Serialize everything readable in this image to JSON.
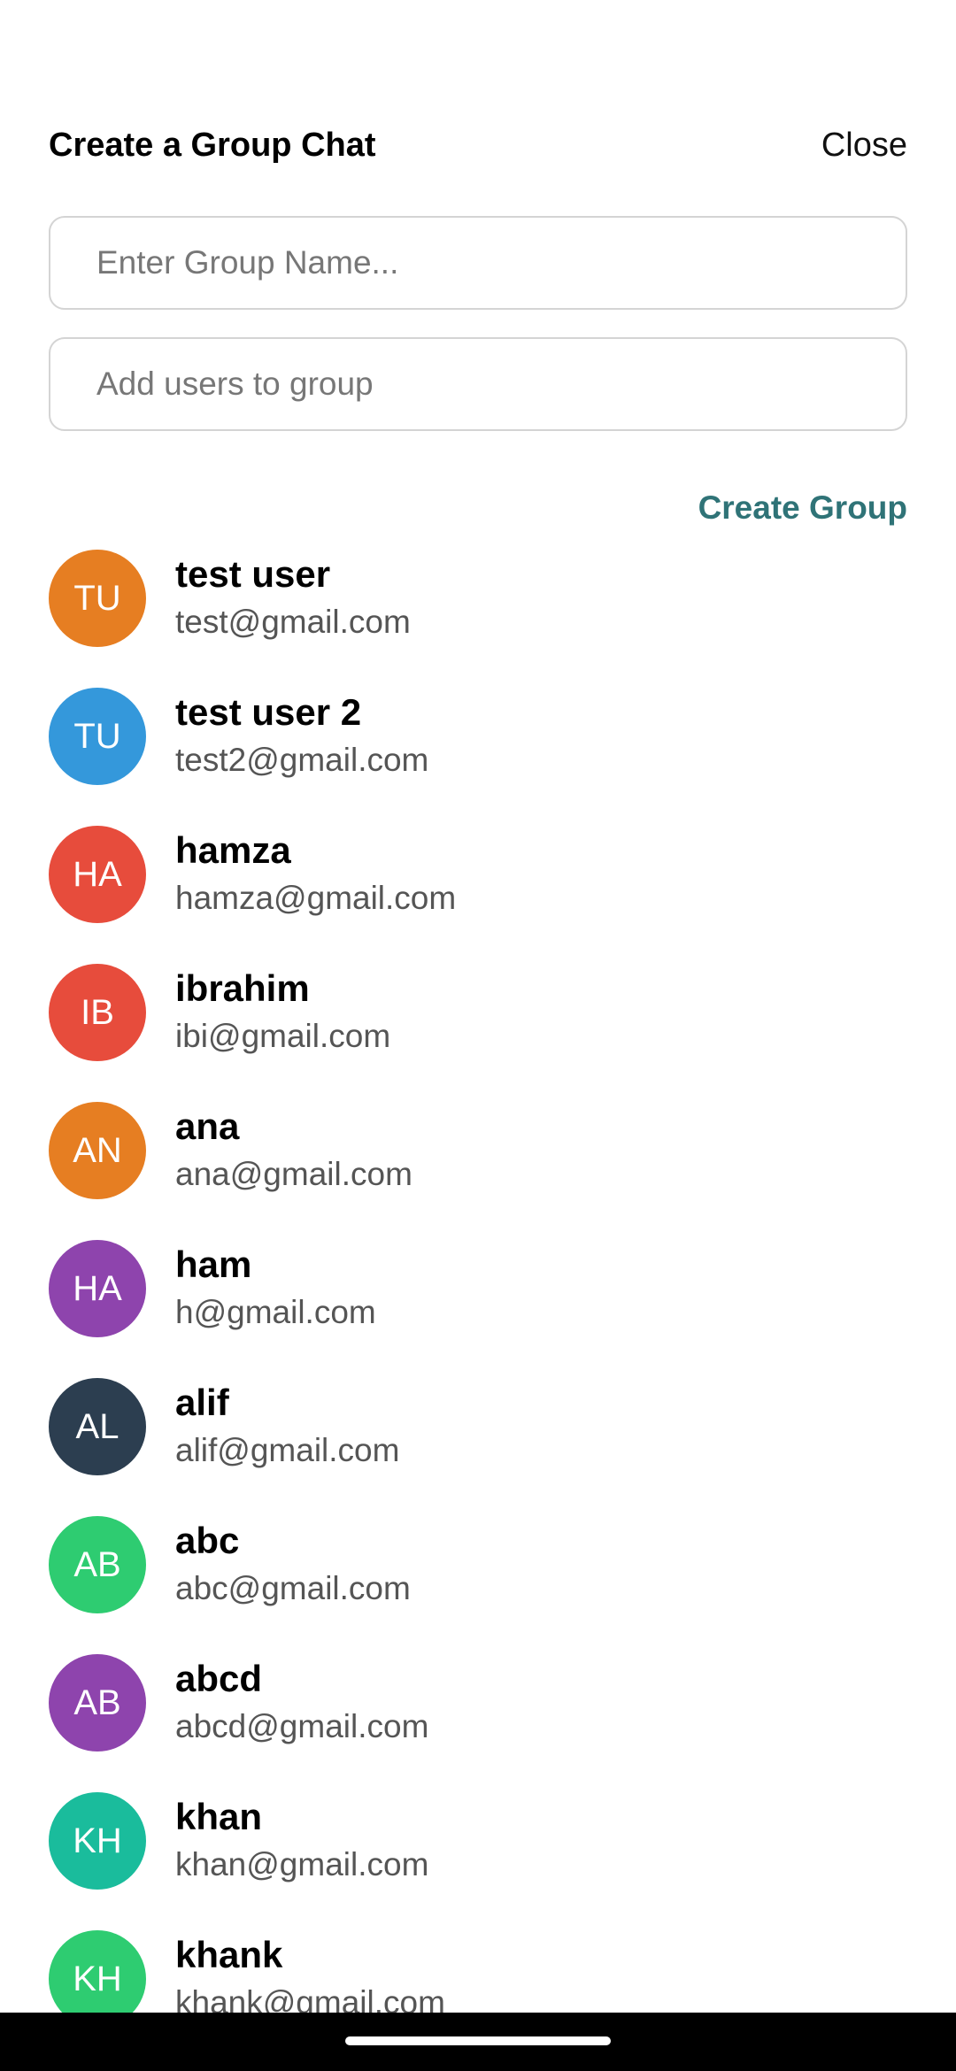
{
  "header": {
    "title": "Create a Group Chat",
    "close_label": "Close"
  },
  "form": {
    "group_name_placeholder": "Enter Group Name...",
    "group_name_value": "",
    "add_users_placeholder": "Add users to group",
    "add_users_value": "",
    "create_label": "Create Group"
  },
  "users": [
    {
      "initials": "TU",
      "name": "test user",
      "email": "test@gmail.com",
      "color": "#e67e22"
    },
    {
      "initials": "TU",
      "name": "test user 2",
      "email": "test2@gmail.com",
      "color": "#3498db"
    },
    {
      "initials": "HA",
      "name": "hamza",
      "email": "hamza@gmail.com",
      "color": "#e74c3c"
    },
    {
      "initials": "IB",
      "name": "ibrahim",
      "email": "ibi@gmail.com",
      "color": "#e74c3c"
    },
    {
      "initials": "AN",
      "name": "ana",
      "email": "ana@gmail.com",
      "color": "#e67e22"
    },
    {
      "initials": "HA",
      "name": "ham",
      "email": "h@gmail.com",
      "color": "#8e44ad"
    },
    {
      "initials": "AL",
      "name": "alif",
      "email": "alif@gmail.com",
      "color": "#2c3e50"
    },
    {
      "initials": "AB",
      "name": "abc",
      "email": "abc@gmail.com",
      "color": "#2ecc71"
    },
    {
      "initials": "AB",
      "name": "abcd",
      "email": "abcd@gmail.com",
      "color": "#8e44ad"
    },
    {
      "initials": "KH",
      "name": "khan",
      "email": "khan@gmail.com",
      "color": "#1abc9c"
    },
    {
      "initials": "KH",
      "name": "khank",
      "email": "khank@gmail.com",
      "color": "#2ecc71"
    }
  ]
}
